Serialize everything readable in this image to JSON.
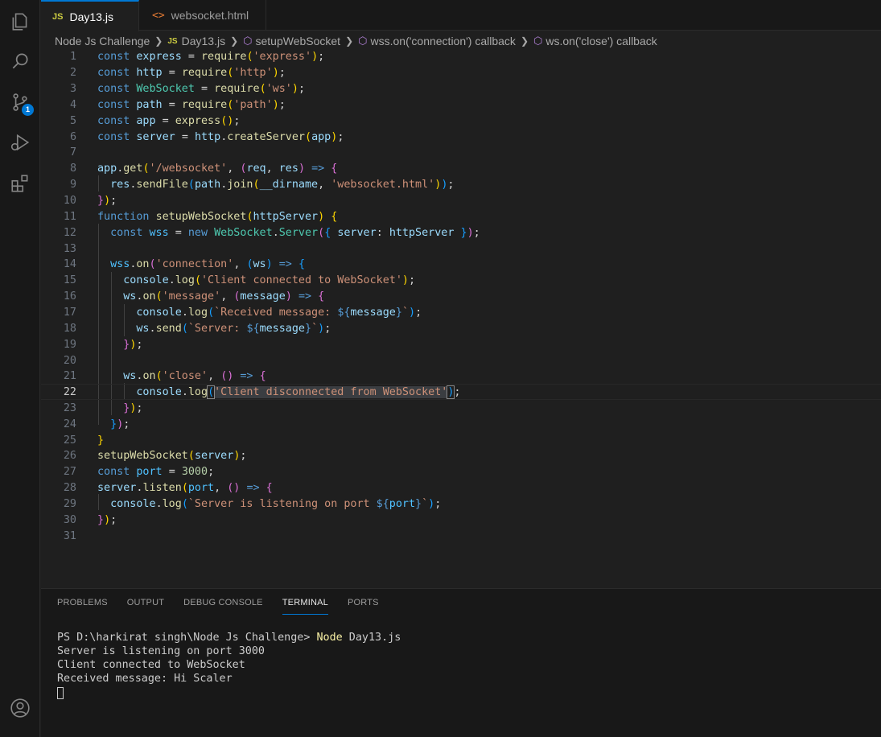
{
  "tabs": [
    {
      "label": "Day13.js",
      "glyph": "JS",
      "active": true
    },
    {
      "label": "websocket.html",
      "glyph": "<>",
      "active": false
    }
  ],
  "breadcrumbs": [
    "Node Js Challenge",
    "Day13.js",
    "setupWebSocket",
    "wss.on('connection') callback",
    "ws.on('close') callback"
  ],
  "activity_bar": {
    "icons": [
      "explorer-icon",
      "search-icon",
      "source-control-icon",
      "run-debug-icon",
      "extensions-icon",
      "account-icon"
    ],
    "source_control_badge": "1"
  },
  "editor": {
    "current_line": 22,
    "line_numbers": [
      "1",
      "2",
      "3",
      "4",
      "5",
      "6",
      "7",
      "8",
      "9",
      "10",
      "11",
      "12",
      "13",
      "14",
      "15",
      "16",
      "17",
      "18",
      "19",
      "20",
      "21",
      "22",
      "23",
      "24",
      "25",
      "26",
      "27",
      "28",
      "29",
      "30",
      "31"
    ]
  },
  "panel": {
    "tabs": [
      "PROBLEMS",
      "OUTPUT",
      "DEBUG CONSOLE",
      "TERMINAL",
      "PORTS"
    ],
    "active_tab": "TERMINAL",
    "terminal": {
      "prompt": "PS D:\\harkirat singh\\Node Js Challenge> ",
      "command": "Node",
      "command_arg": " Day13.js",
      "output": [
        "Server is listening on port 3000",
        "Client connected to WebSocket",
        "Received message: Hi Scaler"
      ]
    }
  },
  "colors": {
    "accent": "#0078d4",
    "editor_bg": "#1f1f1f",
    "panel_bg": "#181818"
  }
}
